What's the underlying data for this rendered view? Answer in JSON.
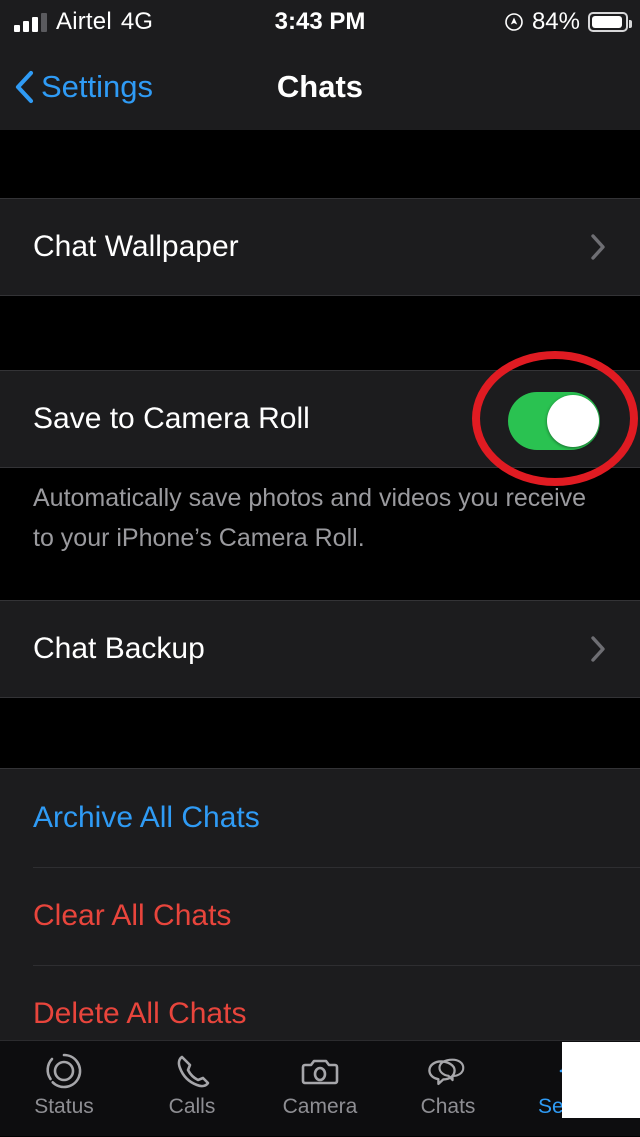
{
  "status_bar": {
    "carrier": "Airtel",
    "network": "4G",
    "time": "3:43 PM",
    "battery_percent": "84%",
    "signal_bars_filled": 3,
    "signal_bars_total": 4,
    "location_icon": "location-arrow-icon",
    "battery_icon": "battery-icon"
  },
  "nav_bar": {
    "back_label": "Settings",
    "back_icon": "chevron-left-icon",
    "title": "Chats"
  },
  "sections": {
    "wallpaper": {
      "row_label": "Chat Wallpaper",
      "disclosure_icon": "chevron-right-icon"
    },
    "save_media": {
      "row_label": "Save to Camera Roll",
      "toggle_state": "on",
      "toggle_on_color": "#2ac251",
      "footer": "Automatically save photos and videos you receive to your iPhone’s Camera Roll."
    },
    "backup": {
      "row_label": "Chat Backup",
      "disclosure_icon": "chevron-right-icon"
    },
    "actions": [
      {
        "label": "Archive All Chats",
        "style": "blue",
        "color": "#2f9bf5"
      },
      {
        "label": "Clear All Chats",
        "style": "red",
        "color": "#e8453c"
      },
      {
        "label": "Delete All Chats",
        "style": "red",
        "color": "#e8453c"
      }
    ]
  },
  "annotation": {
    "shape": "ellipse-highlight",
    "color": "#e01b22",
    "target": "save-to-camera-roll-toggle"
  },
  "tab_bar": {
    "active": "Settings",
    "active_color": "#2f9bf5",
    "inactive_color": "#8e8e93",
    "tabs": [
      {
        "label": "Status",
        "icon": "status-rings-icon"
      },
      {
        "label": "Calls",
        "icon": "phone-icon"
      },
      {
        "label": "Camera",
        "icon": "camera-icon"
      },
      {
        "label": "Chats",
        "icon": "chat-bubbles-icon"
      },
      {
        "label": "Settings",
        "icon": "gear-icon"
      }
    ]
  }
}
